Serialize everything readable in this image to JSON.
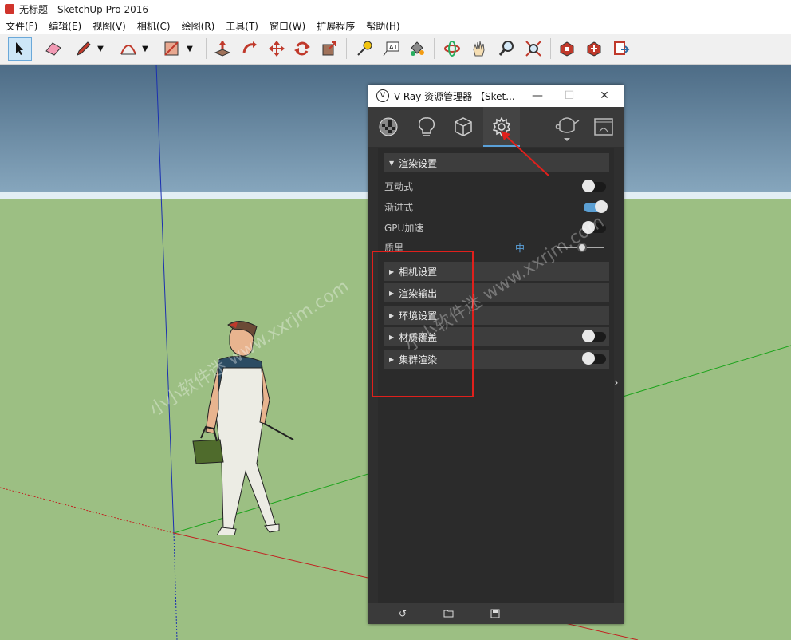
{
  "window": {
    "title": "无标题 - SketchUp Pro 2016"
  },
  "menubar": {
    "items": [
      "文件(F)",
      "编辑(E)",
      "视图(V)",
      "相机(C)",
      "绘图(R)",
      "工具(T)",
      "窗口(W)",
      "扩展程序",
      "帮助(H)"
    ]
  },
  "toolbar": {
    "tools": [
      "select-arrow-icon",
      "eraser-icon",
      "pencil-icon",
      "chevron-down-icon",
      "arc-icon",
      "chevron-down-icon",
      "rectangle-icon",
      "chevron-down-icon",
      "push-pull-icon",
      "follow-me-icon",
      "move-icon",
      "rotate-icon",
      "scale-icon",
      "tape-measure-icon",
      "text-label-icon",
      "paint-bucket-icon",
      "orbit-icon",
      "pan-icon",
      "zoom-icon",
      "zoom-extents-icon",
      "warehouse-icon",
      "extension-warehouse-icon",
      "send-to-layout-icon"
    ],
    "text_tool_label": "A1"
  },
  "vray": {
    "title": "V-Ray 资源管理器 【Sket...",
    "tabs": [
      "materials-icon",
      "lights-icon",
      "geometry-icon",
      "settings-icon",
      "teapot-render-icon",
      "frame-buffer-icon"
    ],
    "render_settings": {
      "header": "渲染设置",
      "options": [
        {
          "label": "互动式",
          "on": false
        },
        {
          "label": "渐进式",
          "on": true
        },
        {
          "label": "GPU加速",
          "on": false
        }
      ],
      "quality_label": "质里",
      "quality_value": "中"
    },
    "sections": [
      {
        "label": "相机设置",
        "has_toggle": false
      },
      {
        "label": "渲染输出",
        "has_toggle": false
      },
      {
        "label": "环境设置",
        "has_toggle": false
      },
      {
        "label": "材质覆盖",
        "has_toggle": true,
        "on": false
      },
      {
        "label": "集群渲染",
        "has_toggle": true,
        "on": false
      }
    ],
    "footer": [
      "revert-icon",
      "open-folder-icon",
      "save-icon"
    ]
  },
  "watermark": {
    "text1": "小小软件迷 www.xxrjm.com",
    "text2": "小小软件迷 www.xxrjm.com"
  },
  "colors": {
    "highlight_red": "#e0201c",
    "toggle_on": "#5b9fd3",
    "panel_bg": "#2f2f2f"
  }
}
